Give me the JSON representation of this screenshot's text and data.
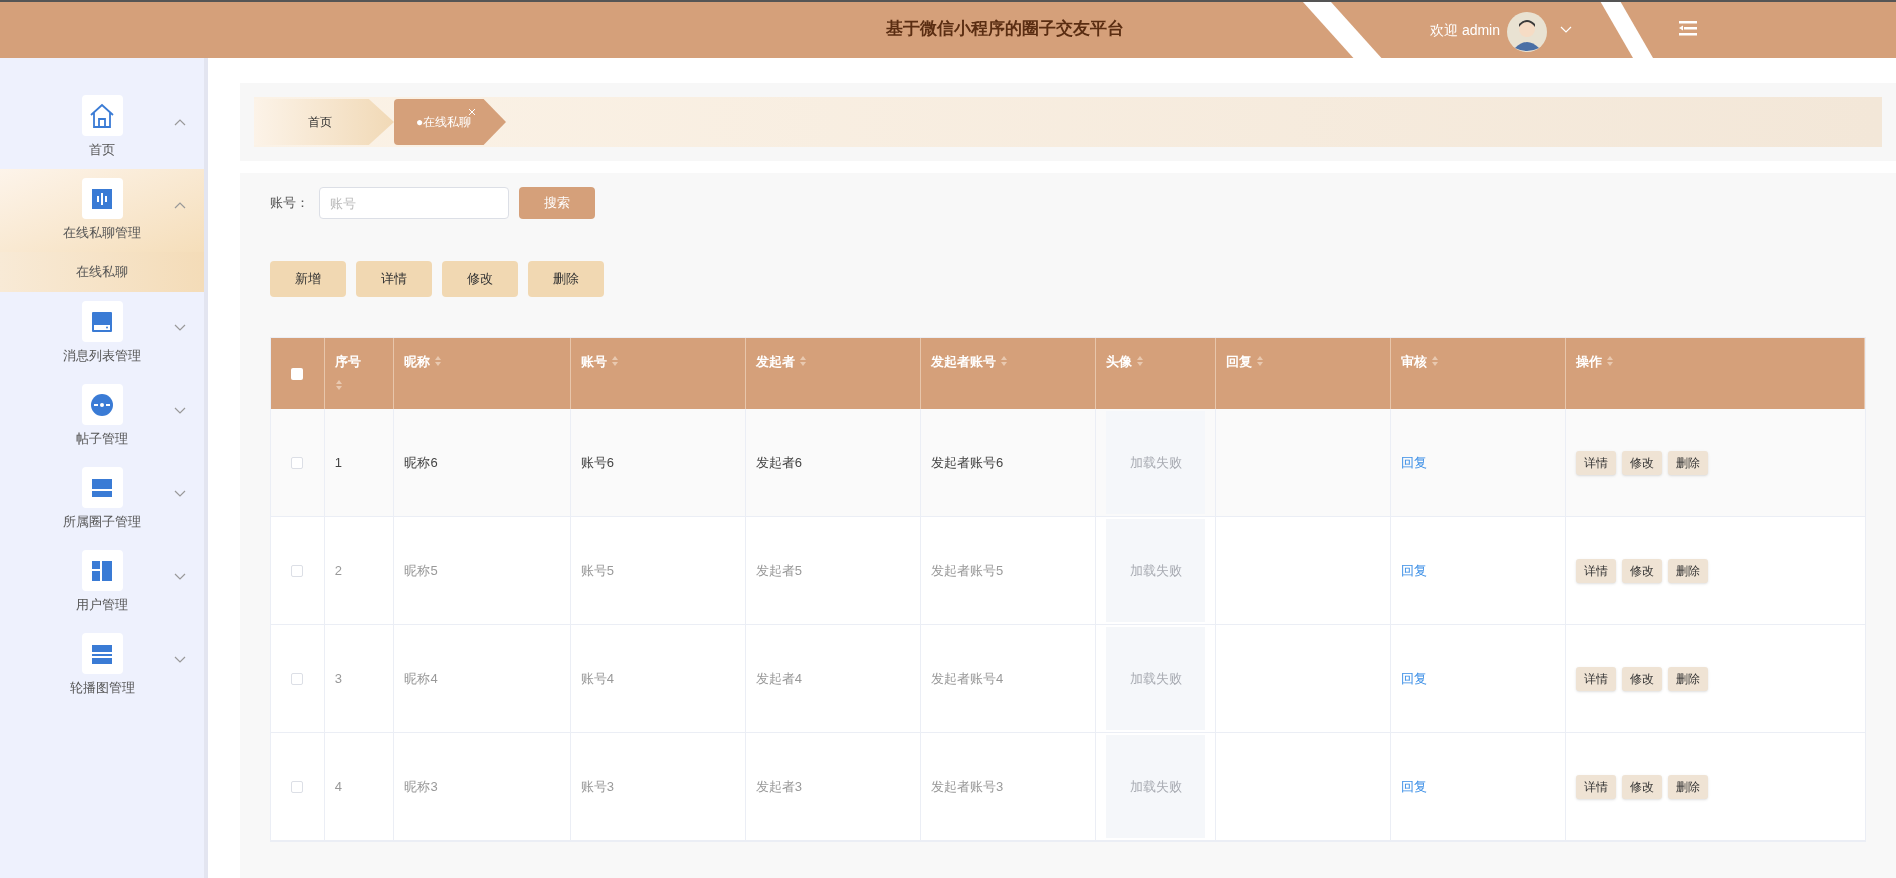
{
  "header": {
    "title": "基于微信小程序的圈子交友平台",
    "welcome": "欢迎 admin"
  },
  "sidebar": {
    "items": [
      {
        "label": "首页",
        "expanded": true,
        "selected": false
      },
      {
        "label": "在线私聊管理",
        "expanded": true,
        "selected": true,
        "children": [
          {
            "label": "在线私聊",
            "selected": true
          }
        ]
      },
      {
        "label": "消息列表管理",
        "expanded": false,
        "selected": false
      },
      {
        "label": "帖子管理",
        "expanded": false,
        "selected": false
      },
      {
        "label": "所属圈子管理",
        "expanded": false,
        "selected": false
      },
      {
        "label": "用户管理",
        "expanded": false,
        "selected": false
      },
      {
        "label": "轮播图管理",
        "expanded": false,
        "selected": false
      }
    ]
  },
  "breadcrumb": [
    {
      "label": "首页",
      "selected": false
    },
    {
      "label": "●在线私聊",
      "selected": true,
      "closable": true
    }
  ],
  "search": {
    "label": "账号：",
    "placeholder": "账号",
    "button": "搜索"
  },
  "toolbar": [
    "新增",
    "详情",
    "修改",
    "删除"
  ],
  "table": {
    "all_checked": false,
    "columns": [
      {
        "label": "序号",
        "sortable": true
      },
      {
        "label": "昵称",
        "sortable": true
      },
      {
        "label": "账号",
        "sortable": true
      },
      {
        "label": "发起者",
        "sortable": true
      },
      {
        "label": "发起者账号",
        "sortable": true
      },
      {
        "label": "头像",
        "sortable": true
      },
      {
        "label": "回复",
        "sortable": true
      },
      {
        "label": "审核",
        "sortable": true
      },
      {
        "label": "操作",
        "sortable": true
      }
    ],
    "rows": [
      {
        "checked": false,
        "index": "1",
        "nickname": "昵称6",
        "account": "账号6",
        "initiator": "发起者6",
        "initiator_account": "发起者账号6",
        "avatar": "加载失败",
        "audit": "回复",
        "actions": [
          "详情",
          "修改",
          "删除"
        ],
        "highlighted": true
      },
      {
        "checked": false,
        "index": "2",
        "nickname": "昵称5",
        "account": "账号5",
        "initiator": "发起者5",
        "initiator_account": "发起者账号5",
        "avatar": "加载失败",
        "audit": "回复",
        "actions": [
          "详情",
          "修改",
          "删除"
        ],
        "highlighted": false
      },
      {
        "checked": false,
        "index": "3",
        "nickname": "昵称4",
        "account": "账号4",
        "initiator": "发起者4",
        "initiator_account": "发起者账号4",
        "avatar": "加载失败",
        "audit": "回复",
        "actions": [
          "详情",
          "修改",
          "删除"
        ],
        "highlighted": false
      },
      {
        "checked": false,
        "index": "4",
        "nickname": "昵称3",
        "account": "账号3",
        "initiator": "发起者3",
        "initiator_account": "发起者账号3",
        "avatar": "加载失败",
        "audit": "回复",
        "actions": [
          "详情",
          "修改",
          "删除"
        ],
        "highlighted": false
      }
    ]
  }
}
